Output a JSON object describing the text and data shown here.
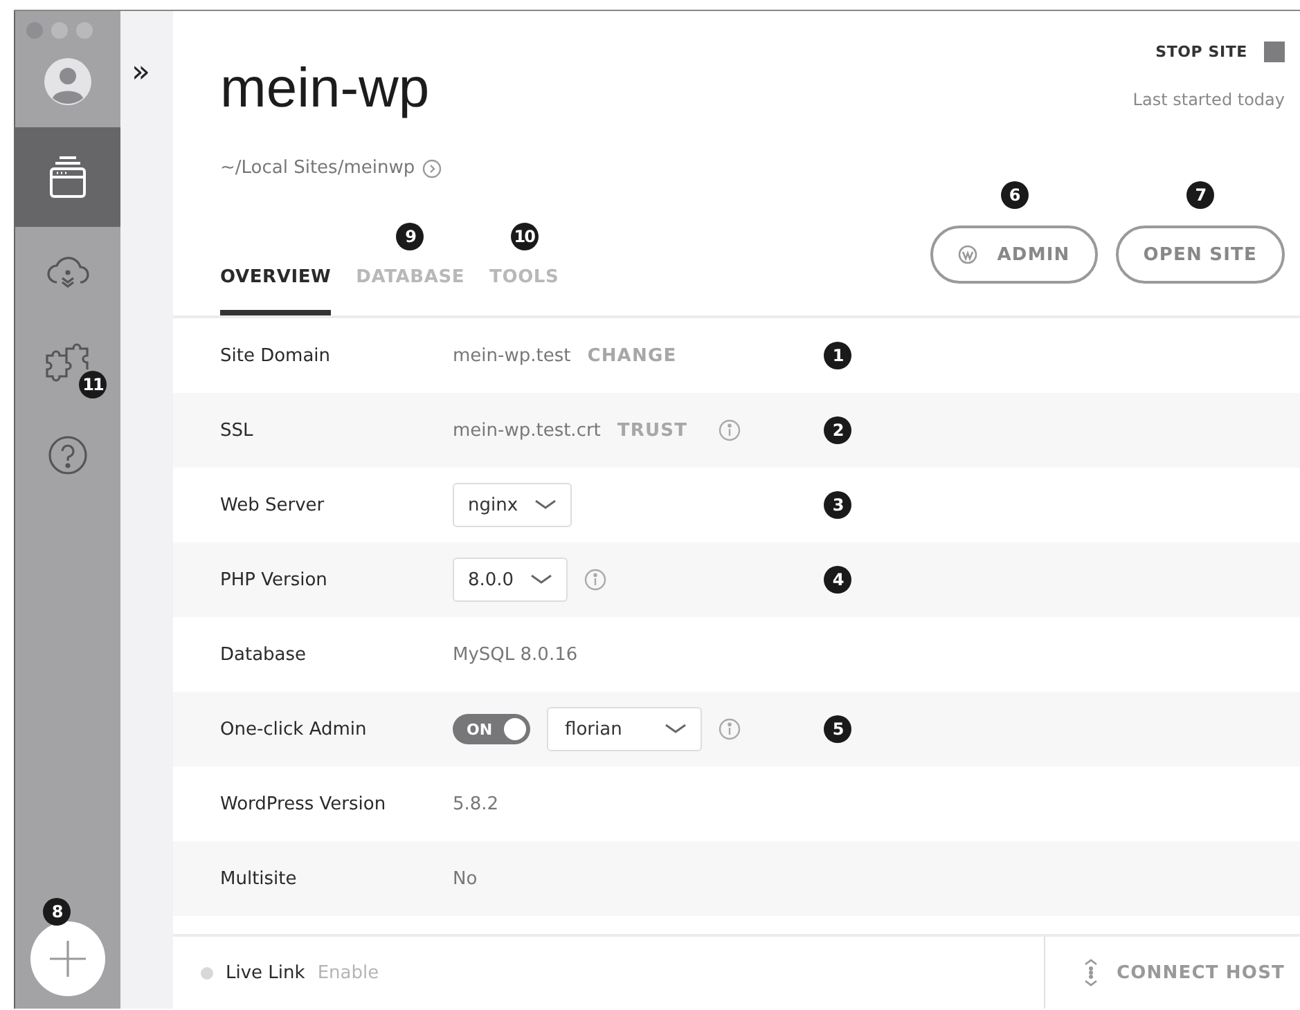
{
  "sidebar": {
    "items": [
      {
        "selected": false
      },
      {
        "selected": true
      },
      {
        "selected": false
      },
      {
        "selected": false,
        "callout": "11"
      },
      {
        "selected": false
      }
    ],
    "add_button": {
      "callout": "8"
    }
  },
  "expand_toggle": "»",
  "site": {
    "title": "mein-wp",
    "path": "~/Local Sites/meinwp",
    "stop_label": "STOP SITE",
    "last_started": "Last started today"
  },
  "tabs": [
    {
      "label": "OVERVIEW",
      "selected": true
    },
    {
      "label": "DATABASE",
      "selected": false,
      "callout": "9"
    },
    {
      "label": "TOOLS",
      "selected": false,
      "callout": "10"
    }
  ],
  "actions": [
    {
      "label": "ADMIN",
      "callout": "6"
    },
    {
      "label": "OPEN SITE",
      "callout": "7"
    }
  ],
  "rows": [
    {
      "label": "Site Domain",
      "kind": "text",
      "value": "mein-wp.test",
      "action": "CHANGE",
      "callout": "1"
    },
    {
      "label": "SSL",
      "kind": "text",
      "value": "mein-wp.test.crt",
      "action": "TRUST",
      "info": true,
      "callout": "2"
    },
    {
      "label": "Web Server",
      "kind": "select",
      "value": "nginx",
      "callout": "3"
    },
    {
      "label": "PHP Version",
      "kind": "select",
      "value": "8.0.0",
      "info": true,
      "callout": "4"
    },
    {
      "label": "Database",
      "kind": "text",
      "value": "MySQL 8.0.16"
    },
    {
      "label": "One-click Admin",
      "kind": "toggle",
      "toggle": {
        "label": "ON",
        "on": true
      },
      "value": "florian",
      "info": true,
      "callout": "5"
    },
    {
      "label": "WordPress Version",
      "kind": "text",
      "value": "5.8.2"
    },
    {
      "label": "Multisite",
      "kind": "text",
      "value": "No"
    }
  ],
  "footer": {
    "live_link": {
      "label": "Live Link",
      "action": "Enable",
      "active": false
    },
    "connect_host": "CONNECT HOST"
  }
}
